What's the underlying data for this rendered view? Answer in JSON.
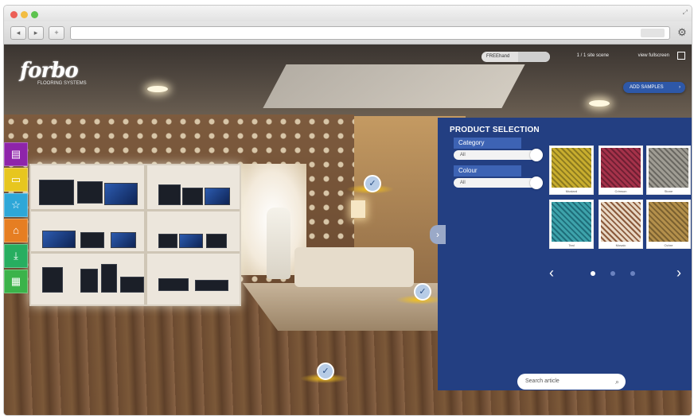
{
  "browser": {
    "back_label": "◂",
    "forward_label": "▸",
    "share_label": "+",
    "settings_icon": "gear-icon"
  },
  "brand": {
    "logo": "forbo",
    "tagline": "FLOORING SYSTEMS"
  },
  "top_controls": {
    "search_pill": "FREEhand",
    "link_1": "1 / 1 site scene",
    "link_2": "view fullscreen",
    "cta_button": "ADD SAMPLES"
  },
  "left_toolbar": {
    "items": [
      {
        "icon": "document-icon",
        "color": "#8e24aa"
      },
      {
        "icon": "folder-icon",
        "color": "#f1c40f"
      },
      {
        "icon": "star-icon",
        "color": "#2ea7d8"
      },
      {
        "icon": "home-icon",
        "color": "#e67e22"
      },
      {
        "icon": "download-icon",
        "color": "#27ae60"
      },
      {
        "icon": "grid-icon",
        "color": "#3bb34a"
      }
    ]
  },
  "panel": {
    "title": "PRODUCT SELECTION",
    "category_label": "Category",
    "category_value": "All",
    "colour_label": "Colour",
    "colour_value": "All",
    "swatches": [
      {
        "name": "Mustard",
        "color_a": "#c8ad2e",
        "color_b": "#8c7a1f"
      },
      {
        "name": "Crimson",
        "color_a": "#a5324a",
        "color_b": "#6f1f33"
      },
      {
        "name": "Stone",
        "color_a": "#9f9c93",
        "color_b": "#6a6862"
      },
      {
        "name": "Teal",
        "color_a": "#3da2aa",
        "color_b": "#1f6e7a"
      },
      {
        "name": "Mosaic",
        "color_a": "#e7d7c3",
        "color_b": "#8b5a3c"
      },
      {
        "name": "Ochre",
        "color_a": "#b38f4b",
        "color_b": "#7b6130"
      }
    ],
    "pages": 3,
    "active_page": 1,
    "search_placeholder": "Search article"
  },
  "colors": {
    "panel_bg": "#233f82",
    "accent_blue": "#2e58a8",
    "hotspot_glow": "#f4c21b"
  }
}
